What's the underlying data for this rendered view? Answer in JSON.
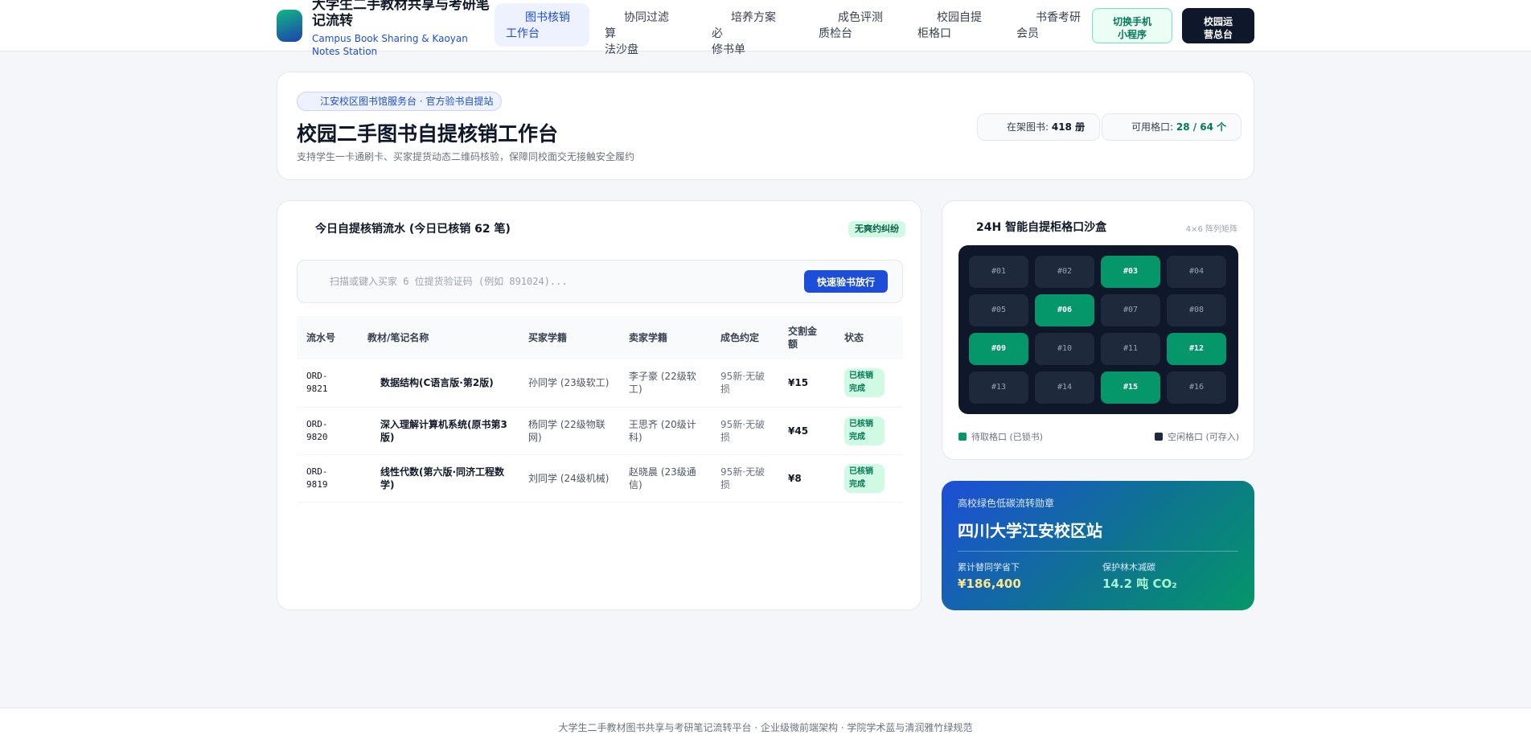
{
  "brand": {
    "title": "大学生二手教材共享与考研笔记流转",
    "subtitle": "Campus Book Sharing & Kaoyan Notes Station"
  },
  "nav": {
    "items": [
      {
        "line1": "图书核销",
        "line2": "工作台",
        "active": true
      },
      {
        "line1": "协同过滤算",
        "line2": "法沙盘",
        "active": false
      },
      {
        "line1": "培养方案必",
        "line2": "修书单",
        "active": false
      },
      {
        "line1": "成色评测",
        "line2": "质检台",
        "active": false
      },
      {
        "line1": "校园自提",
        "line2": "柜格口",
        "active": false
      },
      {
        "line1": "书香考研",
        "line2": "会员",
        "active": false
      }
    ],
    "switch_mini_label_1": "切换手机",
    "switch_mini_label_2": "小程序",
    "ops_label_1": "校园运",
    "ops_label_2": "营总台"
  },
  "hero": {
    "pill": "江安校区图书馆服务台 · 官方验书自提站",
    "title": "校园二手图书自提核销工作台",
    "desc": "支持学生一卡通刷卡、买家提货动态二维码核验，保障同校面交无接触安全履约",
    "stats": [
      {
        "label": "在架图书: ",
        "value": "418 册"
      },
      {
        "label": "可用格口: ",
        "value": "28 / 64 个"
      }
    ]
  },
  "ledger": {
    "title": "今日自提核销流水 (今日已核销 62 笔)",
    "badge": "无爽约纠纷",
    "scan_placeholder": "扫描或键入买家 6 位提货验证码 (例如 891024)...",
    "scan_button": "快速验书放行",
    "columns": [
      "流水号",
      "教材/笔记名称",
      "买家学籍",
      "卖家学籍",
      "成色约定",
      "交割金额",
      "状态"
    ],
    "rows": [
      {
        "id": "ORD-9821",
        "book": "数据结构(C语言版·第2版)",
        "buyer": "孙同学 (23级软工)",
        "seller": "李子豪 (22级软工)",
        "cond": "95新·无破损",
        "price": "¥15",
        "status": "已核销完成"
      },
      {
        "id": "ORD-9820",
        "book": "深入理解计算机系统(原书第3版)",
        "buyer": "杨同学 (22级物联网)",
        "seller": "王思齐 (20级计科)",
        "cond": "95新·无破损",
        "price": "¥45",
        "status": "已核销完成"
      },
      {
        "id": "ORD-9819",
        "book": "线性代数(第六版·同济工程数学)",
        "buyer": "刘同学 (24级机械)",
        "seller": "赵晓晨 (23级通信)",
        "cond": "95新·无破损",
        "price": "¥8",
        "status": "已核销完成"
      }
    ]
  },
  "locker": {
    "title": "24H 智能自提柜格口沙盒",
    "dim": "4×6 阵列矩阵",
    "cells": [
      {
        "label": "#01",
        "occupied": false
      },
      {
        "label": "#02",
        "occupied": false
      },
      {
        "label": "#03",
        "occupied": true
      },
      {
        "label": "#04",
        "occupied": false
      },
      {
        "label": "#05",
        "occupied": false
      },
      {
        "label": "#06",
        "occupied": true
      },
      {
        "label": "#07",
        "occupied": false
      },
      {
        "label": "#08",
        "occupied": false
      },
      {
        "label": "#09",
        "occupied": true
      },
      {
        "label": "#10",
        "occupied": false
      },
      {
        "label": "#11",
        "occupied": false
      },
      {
        "label": "#12",
        "occupied": true
      },
      {
        "label": "#13",
        "occupied": false
      },
      {
        "label": "#14",
        "occupied": false
      },
      {
        "label": "#15",
        "occupied": true
      },
      {
        "label": "#16",
        "occupied": false
      }
    ],
    "legend_occupied": "待取格口 (已锁书)",
    "legend_free": "空闲格口 (可存入)"
  },
  "green": {
    "label": "高校绿色低碳流转勋章",
    "title": "四川大学江安校区站",
    "saved_label": "累计替同学省下",
    "saved_value": "¥186,400",
    "co2_label": "保护林木减碳",
    "co2_value": "14.2 吨 CO₂"
  },
  "footer": "大学生二手教材图书共享与考研笔记流转平台 · 企业级微前端架构 · 学院学术蓝与清润雅竹绿规范",
  "colors": {
    "accent_blue": "#1d4ed8",
    "accent_green": "#059669",
    "dark": "#0f172a"
  }
}
